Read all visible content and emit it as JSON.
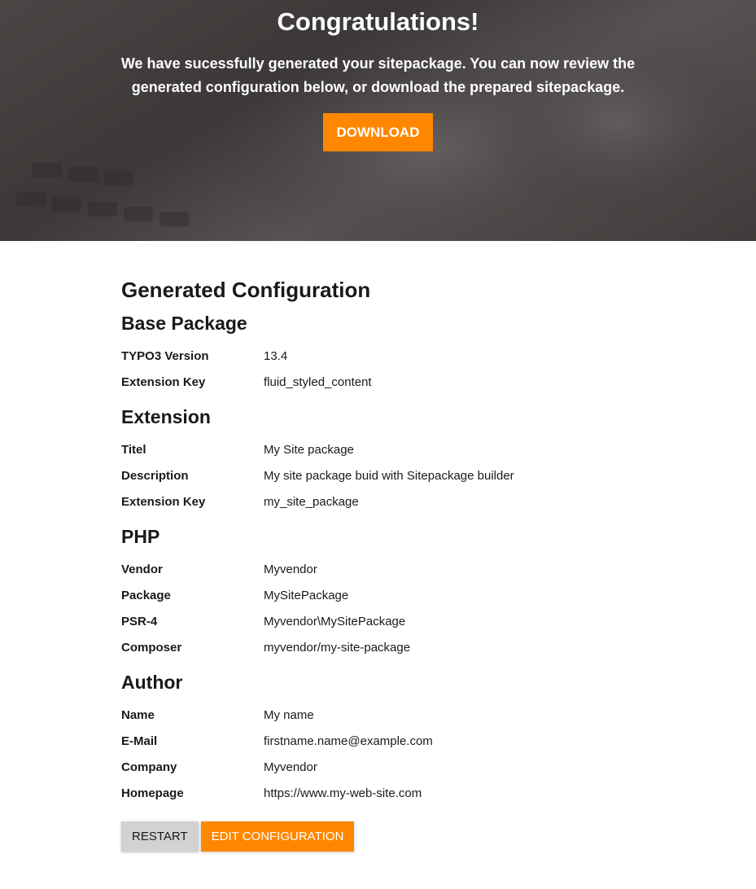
{
  "hero": {
    "title": "Congratulations!",
    "message_line1": "We have sucessfully generated your sitepackage. You can now review the",
    "message_line2": "generated configuration below, or download the prepared sitepackage.",
    "download_label": "DOWNLOAD"
  },
  "config": {
    "heading": "Generated Configuration",
    "sections": [
      {
        "title": "Base Package",
        "rows": [
          {
            "key": "TYPO3 Version",
            "value": "13.4"
          },
          {
            "key": "Extension Key",
            "value": "fluid_styled_content"
          }
        ]
      },
      {
        "title": "Extension",
        "rows": [
          {
            "key": "Titel",
            "value": "My Site package"
          },
          {
            "key": "Description",
            "value": "My site package buid with Sitepackage builder"
          },
          {
            "key": "Extension Key",
            "value": "my_site_package"
          }
        ]
      },
      {
        "title": "PHP",
        "rows": [
          {
            "key": "Vendor",
            "value": "Myvendor"
          },
          {
            "key": "Package",
            "value": "MySitePackage"
          },
          {
            "key": "PSR-4",
            "value": "Myvendor\\MySitePackage"
          },
          {
            "key": "Composer",
            "value": "myvendor/my-site-package"
          }
        ]
      },
      {
        "title": "Author",
        "rows": [
          {
            "key": "Name",
            "value": "My name"
          },
          {
            "key": "E-Mail",
            "value": "firstname.name@example.com"
          },
          {
            "key": "Company",
            "value": "Myvendor"
          },
          {
            "key": "Homepage",
            "value": "https://www.my-web-site.com"
          }
        ]
      }
    ]
  },
  "actions": {
    "restart_label": "RESTART",
    "edit_label": "EDIT CONFIGURATION"
  },
  "colors": {
    "accent": "#ff8700",
    "secondary_button": "#d2d2d2"
  }
}
